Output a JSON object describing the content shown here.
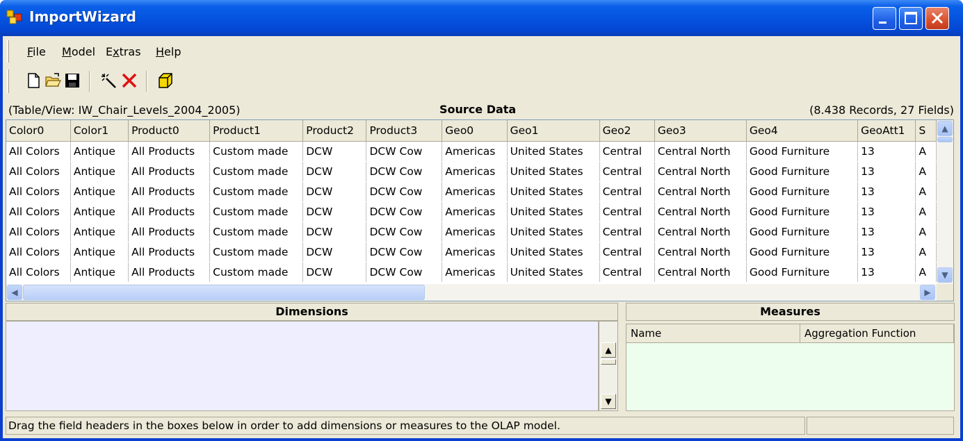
{
  "window": {
    "title": "ImportWizard"
  },
  "menu": [
    {
      "label_pre": "",
      "label_u": "F",
      "label_post": "ile"
    },
    {
      "label_pre": "",
      "label_u": "M",
      "label_post": "odel"
    },
    {
      "label_pre": "E",
      "label_u": "x",
      "label_post": "tras"
    },
    {
      "label_pre": "",
      "label_u": "H",
      "label_post": "elp"
    }
  ],
  "toolbar": [
    "new-icon",
    "open-folder-icon",
    "save-icon",
    "magic-wand-icon",
    "delete-icon",
    "cube-icon"
  ],
  "source": {
    "table_info": "(Table/View: IW_Chair_Levels_2004_2005)",
    "title": "Source Data",
    "counts": "(8.438 Records, 27 Fields)"
  },
  "grid": {
    "columns": [
      "Color0",
      "Color1",
      "Product0",
      "Product1",
      "Product2",
      "Product3",
      "Geo0",
      "Geo1",
      "Geo2",
      "Geo3",
      "Geo4",
      "GeoAtt1",
      "S"
    ],
    "rows": [
      [
        "All Colors",
        "Antique",
        "All Products",
        "Custom made",
        "DCW",
        "DCW Cow",
        "Americas",
        "United States",
        "Central",
        "Central North",
        "Good Furniture",
        "13",
        "A"
      ],
      [
        "All Colors",
        "Antique",
        "All Products",
        "Custom made",
        "DCW",
        "DCW Cow",
        "Americas",
        "United States",
        "Central",
        "Central North",
        "Good Furniture",
        "13",
        "A"
      ],
      [
        "All Colors",
        "Antique",
        "All Products",
        "Custom made",
        "DCW",
        "DCW Cow",
        "Americas",
        "United States",
        "Central",
        "Central North",
        "Good Furniture",
        "13",
        "A"
      ],
      [
        "All Colors",
        "Antique",
        "All Products",
        "Custom made",
        "DCW",
        "DCW Cow",
        "Americas",
        "United States",
        "Central",
        "Central North",
        "Good Furniture",
        "13",
        "A"
      ],
      [
        "All Colors",
        "Antique",
        "All Products",
        "Custom made",
        "DCW",
        "DCW Cow",
        "Americas",
        "United States",
        "Central",
        "Central North",
        "Good Furniture",
        "13",
        "A"
      ],
      [
        "All Colors",
        "Antique",
        "All Products",
        "Custom made",
        "DCW",
        "DCW Cow",
        "Americas",
        "United States",
        "Central",
        "Central North",
        "Good Furniture",
        "13",
        "A"
      ],
      [
        "All Colors",
        "Antique",
        "All Products",
        "Custom made",
        "DCW",
        "DCW Cow",
        "Americas",
        "United States",
        "Central",
        "Central North",
        "Good Furniture",
        "13",
        "A"
      ]
    ]
  },
  "dimensions": {
    "title": "Dimensions"
  },
  "measures": {
    "title": "Measures",
    "columns": [
      "Name",
      "Aggregation Function"
    ]
  },
  "status": {
    "text": "Drag the field headers in the boxes below in order to add dimensions or measures to the OLAP model."
  },
  "colors": {
    "title_bar": "#0554e0",
    "dimensions_bg": "#eeeefe",
    "measures_bg": "#eefeee",
    "face": "#ece9d8"
  }
}
